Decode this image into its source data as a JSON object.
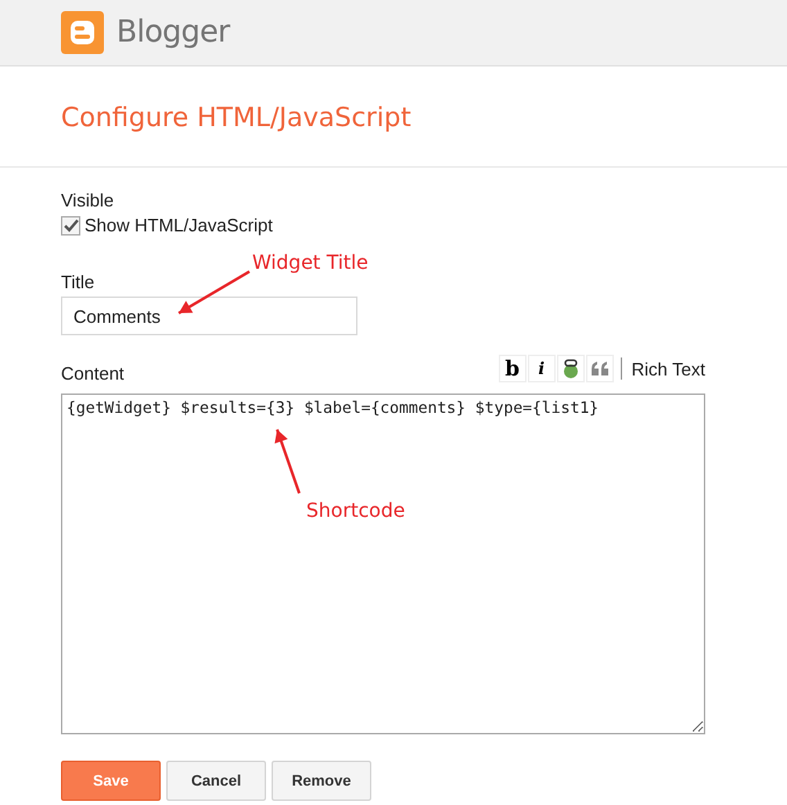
{
  "header": {
    "brand": "Blogger"
  },
  "page_title": "Configure HTML/JavaScript",
  "visible": {
    "label": "Visible",
    "checkbox_label": "Show HTML/JavaScript",
    "checked": true
  },
  "title_field": {
    "label": "Title",
    "value": "Comments"
  },
  "content": {
    "label": "Content",
    "value": "{getWidget} $results={3} $label={comments} $type={list1}",
    "toolbar": [
      {
        "kind": "bold",
        "text": "b"
      },
      {
        "kind": "italic",
        "text": "i"
      },
      {
        "kind": "link"
      },
      {
        "kind": "quote"
      }
    ],
    "rich_text": "Rich Text"
  },
  "annotations": [
    {
      "kind": "title",
      "text": "Widget Title"
    },
    {
      "kind": "content",
      "text": "Shortcode"
    }
  ],
  "buttons": [
    {
      "label": "Save",
      "primary": true
    },
    {
      "label": "Cancel",
      "primary": false
    },
    {
      "label": "Remove",
      "primary": false
    }
  ]
}
